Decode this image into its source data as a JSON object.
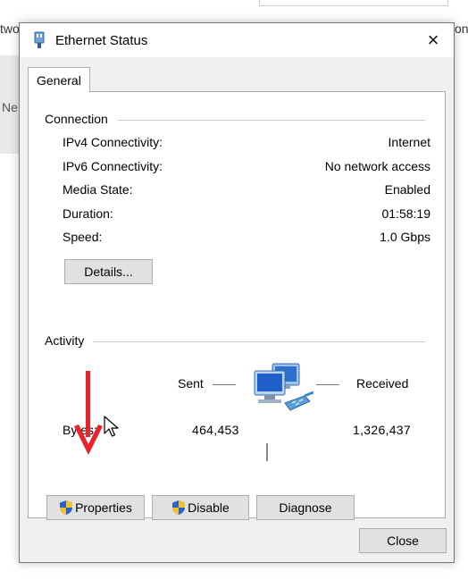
{
  "background": {
    "left_text": "two",
    "left_text2": "Ne",
    "right_text": "on"
  },
  "dialog": {
    "title": "Ethernet Status",
    "close_label": "×"
  },
  "tabs": [
    {
      "label": "General"
    }
  ],
  "connection": {
    "heading": "Connection",
    "rows": [
      {
        "label": "IPv4 Connectivity:",
        "value": "Internet"
      },
      {
        "label": "IPv6 Connectivity:",
        "value": "No network access"
      },
      {
        "label": "Media State:",
        "value": "Enabled"
      },
      {
        "label": "Duration:",
        "value": "01:58:19"
      },
      {
        "label": "Speed:",
        "value": "1.0 Gbps"
      }
    ],
    "details_button": "Details..."
  },
  "activity": {
    "heading": "Activity",
    "sent_label": "Sent",
    "received_label": "Received",
    "bytes_label": "Bytes:",
    "bytes_sent": "464,453",
    "bytes_received": "1,326,437"
  },
  "buttons": {
    "properties": "Properties",
    "disable": "Disable",
    "diagnose": "Diagnose",
    "close": "Close"
  },
  "colors": {
    "annotation_arrow": "#e8232a",
    "shield_blue": "#2a62c9",
    "shield_yellow": "#f2c12e"
  },
  "icons": [
    "ethernet-icon",
    "network-computers-icon",
    "shield-icon",
    "mouse-cursor-icon",
    "red-arrow-annotation"
  ]
}
